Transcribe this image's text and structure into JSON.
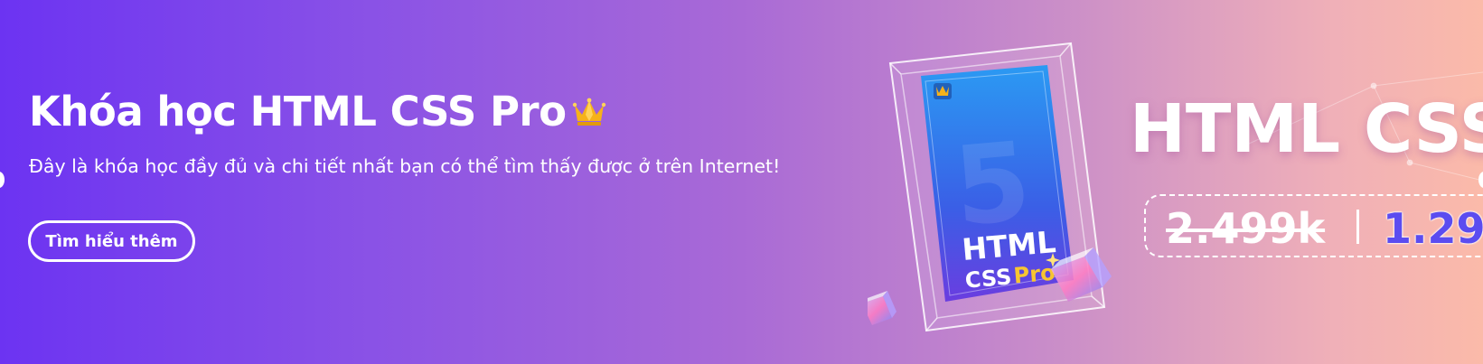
{
  "banner": {
    "title": "Khóa học HTML CSS Pro",
    "subtitle": "Đây là khóa học đầy đủ và chi tiết nhất bạn có thể tìm thấy được ở trên Internet!",
    "cta_label": "Tìm hiểu thêm",
    "title_icon": "crown-icon"
  },
  "artwork": {
    "card_line1": "HTML",
    "card_line2": "CSS",
    "card_line3": "Pro",
    "card_badge_icon": "crown-icon",
    "headline": "HTML CSS P",
    "old_price": "2.499k",
    "new_price": "1.29"
  },
  "colors": {
    "gradient_start": "#6c33f2",
    "gradient_end": "#fbbaa9",
    "crown": "#f6b21a",
    "card_blue": "#2f8bf0",
    "price_accent": "#5b4cf0",
    "pro_yellow": "#f7c531"
  }
}
